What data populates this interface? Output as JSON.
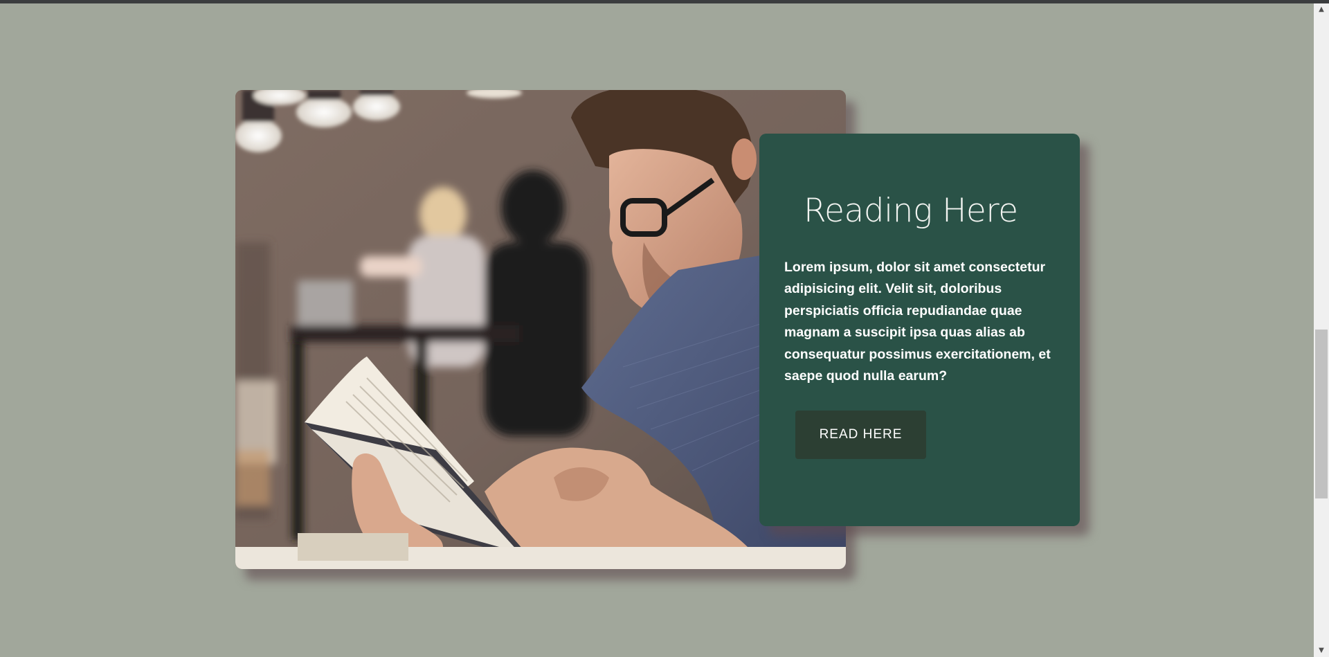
{
  "feature": {
    "title": "Reading Here",
    "body": "Lorem ipsum, dolor sit amet consectetur adipisicing elit. Velit sit, doloribus perspiciatis officia repudiandae quae magnam a suscipit ipsa quas alias ab consequatur possimus exercitationem, et saepe quod nulla earum?",
    "button_label": "READ HERE",
    "image_icon": "man-reading-book-photo"
  },
  "scrollbar": {
    "up_icon": "arrow-up-icon",
    "down_icon": "arrow-down-icon",
    "up_glyph": "▲",
    "down_glyph": "▼"
  },
  "colors": {
    "page_background": "#a1a79b",
    "card_background": "#2a5247",
    "button_background": "#2c3f33",
    "text": "#ffffff"
  }
}
